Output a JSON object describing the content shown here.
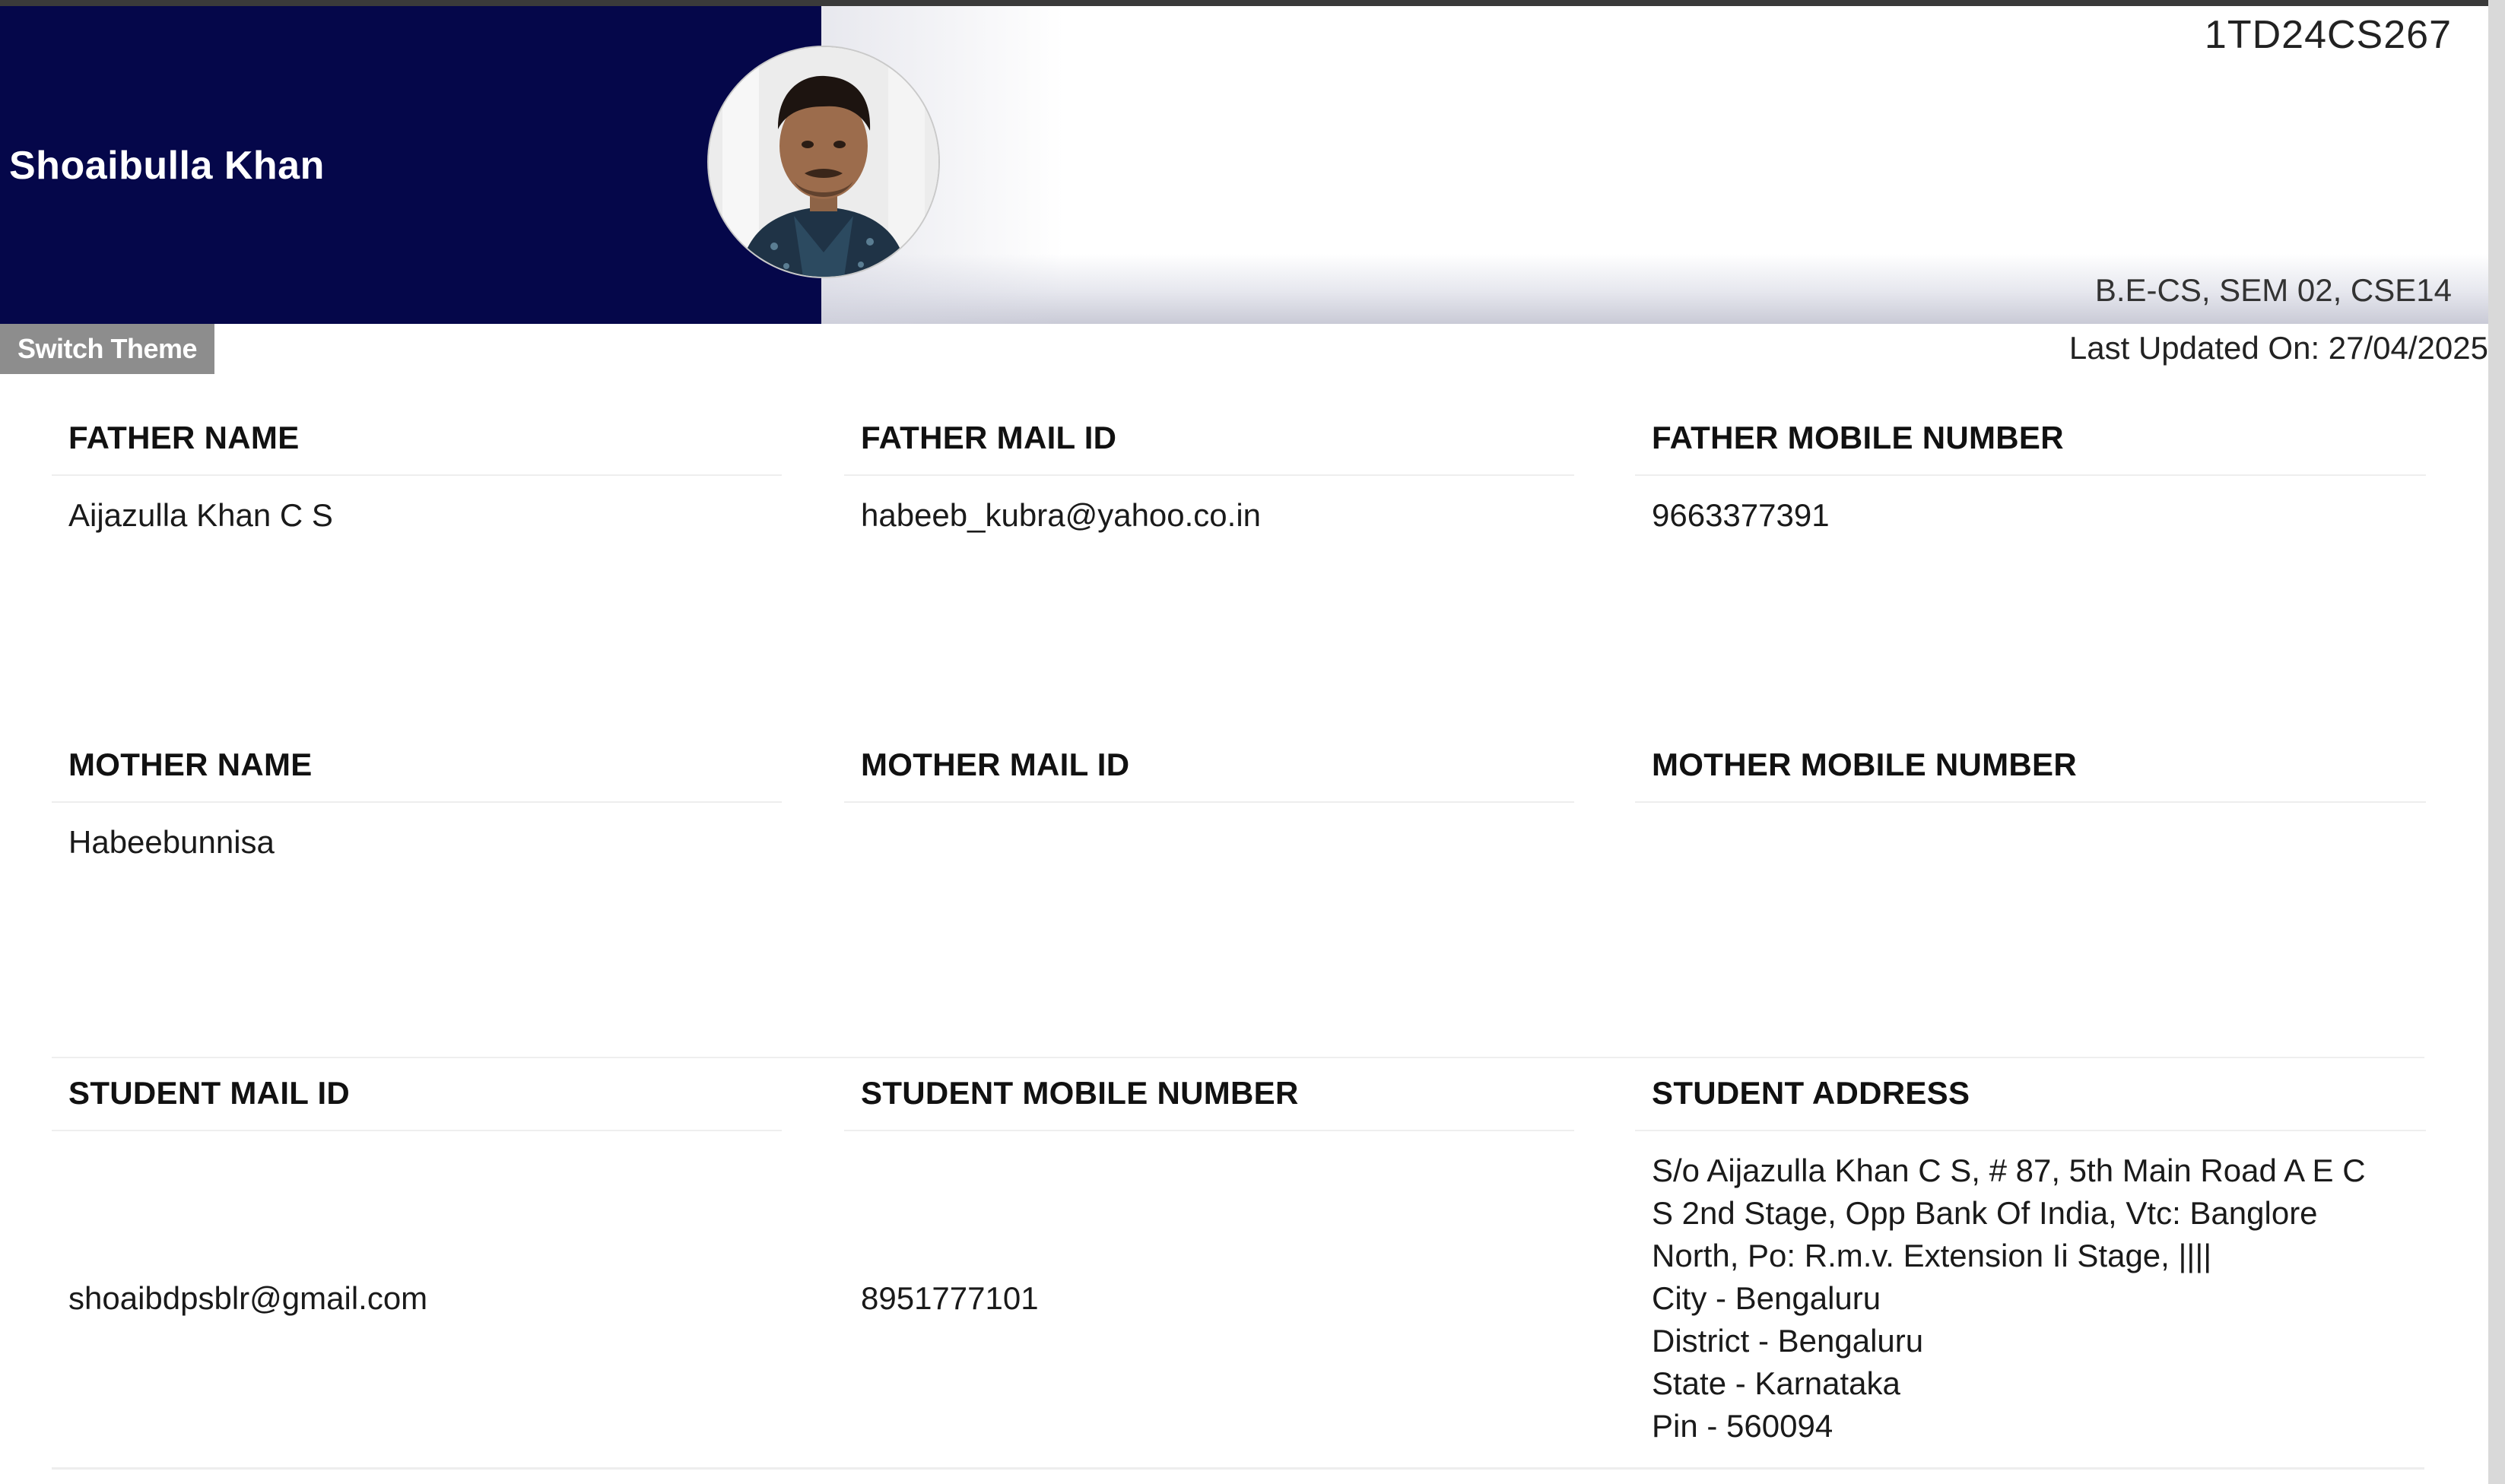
{
  "header": {
    "student_name": "Shoaibulla Khan",
    "usn": "1TD24CS267",
    "program": "B.E-CS, SEM 02, CSE14",
    "colors": {
      "banner": "#05074a",
      "button": "#8d8d8d"
    }
  },
  "toolbar": {
    "switch_theme_label": "Switch Theme",
    "last_updated": "Last Updated On: 27/04/2025"
  },
  "details": {
    "father": {
      "name_label": "FATHER NAME",
      "name": "Aijazulla Khan C S",
      "mail_label": "FATHER MAIL ID",
      "mail": "habeeb_kubra@yahoo.co.in",
      "mobile_label": "FATHER MOBILE NUMBER",
      "mobile": "9663377391"
    },
    "mother": {
      "name_label": "MOTHER NAME",
      "name": "Habeebunnisa",
      "mail_label": "MOTHER MAIL ID",
      "mail": "",
      "mobile_label": "MOTHER MOBILE NUMBER",
      "mobile": ""
    },
    "student": {
      "mail_label": "STUDENT MAIL ID",
      "mail": "shoaibdpsblr@gmail.com",
      "mobile_label": "STUDENT MOBILE NUMBER",
      "mobile": "8951777101",
      "address_label": "STUDENT ADDRESS",
      "address_lines": [
        "S/o Aijazulla Khan C S, # 87, 5th Main Road A E C",
        "S 2nd Stage, Opp Bank Of India, Vtc: Banglore",
        "North, Po: R.m.v. Extension Ii Stage, ||||",
        "City - Bengaluru",
        "District - Bengaluru",
        "State - Karnataka",
        "Pin - 560094"
      ]
    }
  }
}
